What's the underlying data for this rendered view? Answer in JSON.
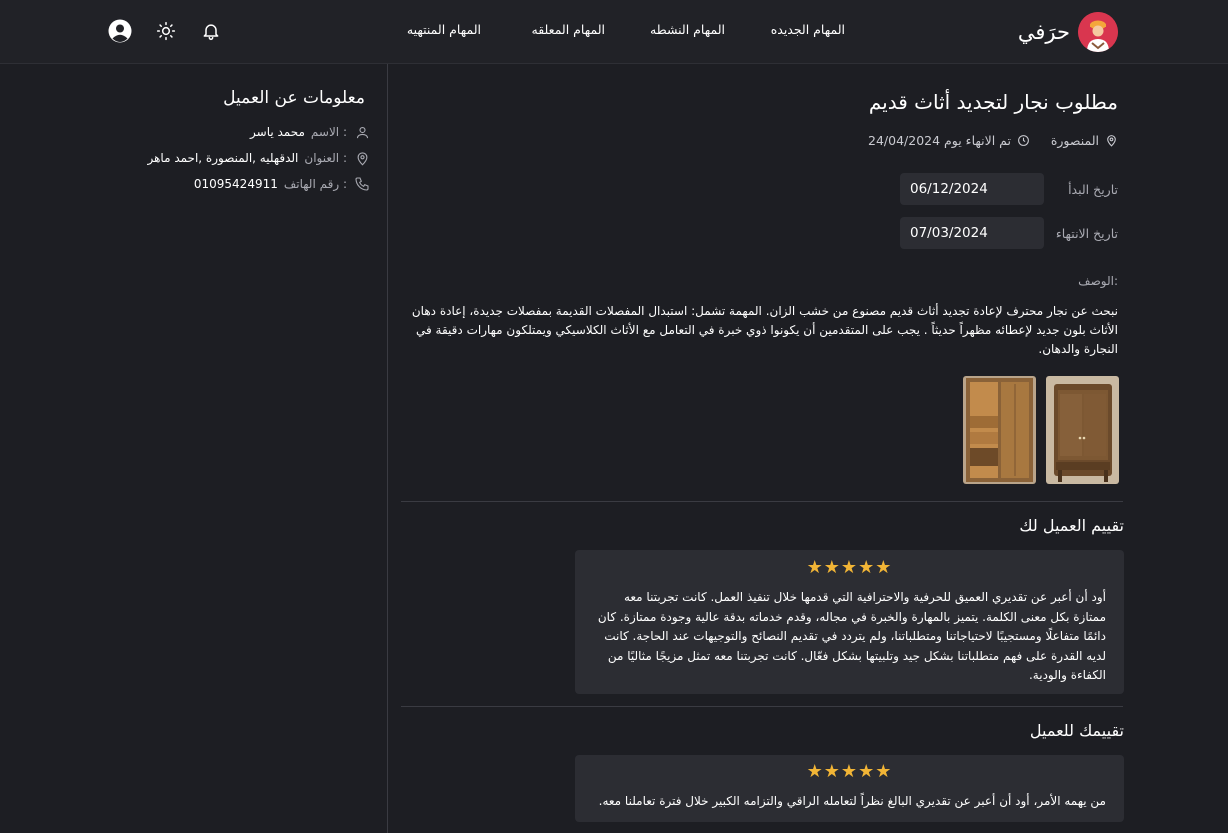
{
  "brand": {
    "name": "حرَفي"
  },
  "nav": {
    "links": [
      "المهام الجديده",
      "المهام النشطه",
      "المهام المعلقه",
      "المهام المنتهيه"
    ],
    "icons": [
      "bell-icon",
      "sun-icon",
      "user-avatar-icon"
    ]
  },
  "client": {
    "title": "معلومات عن العميل",
    "name_label": "الاسم :",
    "name_value": "محمد ياسر",
    "address_label": "العنوان :",
    "address_value": "الدقهليه ,المنصورة ,احمد ماهر",
    "phone_label": "رقم الهاتف :",
    "phone_value": "01095424911"
  },
  "task": {
    "title": "مطلوب نجار لتجديد أثاث قديم",
    "location": "المنصورة",
    "finished": "تم الانهاء يوم 24/04/2024",
    "start_label": "تاريخ البدأ",
    "start_value": "06/12/2024",
    "end_label": "تاريخ الانتهاء",
    "end_value": "07/03/2024",
    "desc_label": "الوصف:",
    "description": "نبحث عن نجار محترف لإعادة تجديد أثاث قديم مصنوع من خشب الزان. المهمة تشمل: استبدال المفصلات القديمة بمفصلات جديدة، إعادة دهان الأثاث بلون جديد لإعطائه مظهراً حديثاً . يجب على المتقدمين أن يكونوا ذوي خبرة في التعامل مع الأثاث الكلاسيكي ويمتلكون مهارات دقيقة في النجارة والدهان."
  },
  "client_review": {
    "title": "تقييم العميل لك",
    "rating": 5,
    "text": "أود أن أعبر عن تقديري العميق للحرفية والاحترافية التي قدمها خلال تنفيذ العمل. كانت تجربتنا معه ممتازة بكل معنى الكلمة. يتميز بالمهارة والخبرة في مجاله، وقدم خدماته بدقة عالية وجودة ممتازة. كان دائمًا متفاعلًا ومستجيبًا لاحتياجاتنا ومتطلباتنا، ولم يتردد في تقديم النصائح والتوجيهات عند الحاجة. كانت لديه القدرة على فهم متطلباتنا بشكل جيد وتلبيتها بشكل فعّال. كانت تجربتنا معه تمثل مزيجًا مثاليًا من الكفاءة والودية."
  },
  "your_review": {
    "title": "تقييمك للعميل",
    "rating": 5,
    "text": "من يهمه الأمر، أود أن أعبر عن تقديري البالغ نظراً لتعامله الراقي والتزامه الكبير خلال فترة تعاملنا معه."
  },
  "stars_text": "★★★★★",
  "colors": {
    "accent_star": "#f2b536",
    "brand": "#d9364f",
    "background": "#1d1e23",
    "card": "#2c2d33"
  }
}
